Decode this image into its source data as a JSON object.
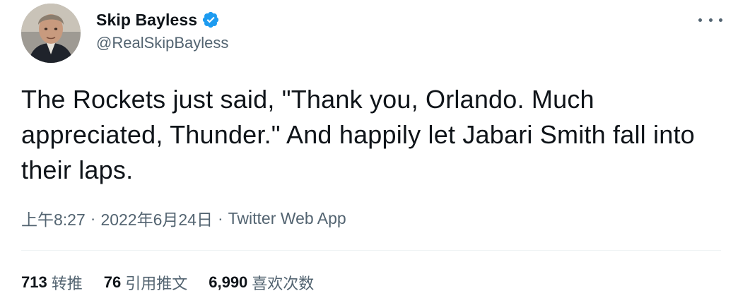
{
  "author": {
    "display_name": "Skip Bayless",
    "handle": "@RealSkipBayless",
    "verified": true,
    "verified_color": "#1d9bf0"
  },
  "tweet": {
    "text": "The Rockets just said, \"Thank you, Orlando. Much appreciated, Thunder.\" And happily let Jabari Smith fall into their laps."
  },
  "meta": {
    "time": "上午8:27",
    "separator": "·",
    "date": "2022年6月24日",
    "source": "Twitter Web App"
  },
  "stats": {
    "retweets": {
      "count": "713",
      "label": "转推"
    },
    "quotes": {
      "count": "76",
      "label": "引用推文"
    },
    "likes": {
      "count": "6,990",
      "label": "喜欢次数"
    }
  },
  "icons": {
    "more": "more-horizontal-icon",
    "verified": "verified-badge-icon"
  },
  "colors": {
    "text_primary": "#0f1419",
    "text_secondary": "#536471",
    "divider": "#eff3f4"
  }
}
